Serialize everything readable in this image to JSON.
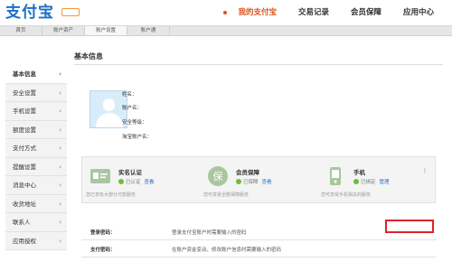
{
  "header": {
    "logo": "支付宝",
    "nav": [
      {
        "label": "我的支付宝",
        "active": true
      },
      {
        "label": "交易记录",
        "active": false
      },
      {
        "label": "会员保障",
        "active": false
      },
      {
        "label": "应用中心",
        "active": false
      }
    ]
  },
  "subnav": [
    "首页",
    "账户资产",
    "账户设置",
    "账户通"
  ],
  "sidebar": {
    "items": [
      {
        "label": "基本信息",
        "active": true
      },
      {
        "label": "安全设置"
      },
      {
        "label": "手机设置"
      },
      {
        "label": "额度设置"
      },
      {
        "label": "支付方式"
      },
      {
        "label": "提醒设置"
      },
      {
        "label": "消息中心"
      },
      {
        "label": "收货地址"
      },
      {
        "label": "联系人"
      },
      {
        "label": "应用授权"
      }
    ],
    "chevron": "›"
  },
  "main": {
    "title": "基本信息",
    "profile": {
      "name_label": "姓名：",
      "account_label": "账户名：",
      "security_label": "安全等级：",
      "taobao_label": "淘宝账户名："
    },
    "cards": [
      {
        "title": "实名认证",
        "status": "已认证",
        "link": "查看",
        "desc": "您已享有大部分付款服务",
        "icon": "id-card-icon"
      },
      {
        "title": "会员保障",
        "status": "已保障",
        "link": "查看",
        "desc": "您可享受全额保障服务",
        "icon": "shield-bao-icon"
      },
      {
        "title": "手机",
        "status": "已绑定",
        "link": "管理",
        "desc": "您可享受手机相关的服务",
        "icon": "phone-icon",
        "paren": ")"
      }
    ],
    "passwords": [
      {
        "label": "登录密码：",
        "desc": "登录支付宝账户时需要输入的密码"
      },
      {
        "label": "支付密码：",
        "desc": "在账户资金变动、修改账户信息时需要输入的密码"
      }
    ]
  },
  "colors": {
    "accent": "#d9531e",
    "brand": "#1a6fc9",
    "highlight": "#e0212b",
    "ok": "#6dbd3a"
  }
}
